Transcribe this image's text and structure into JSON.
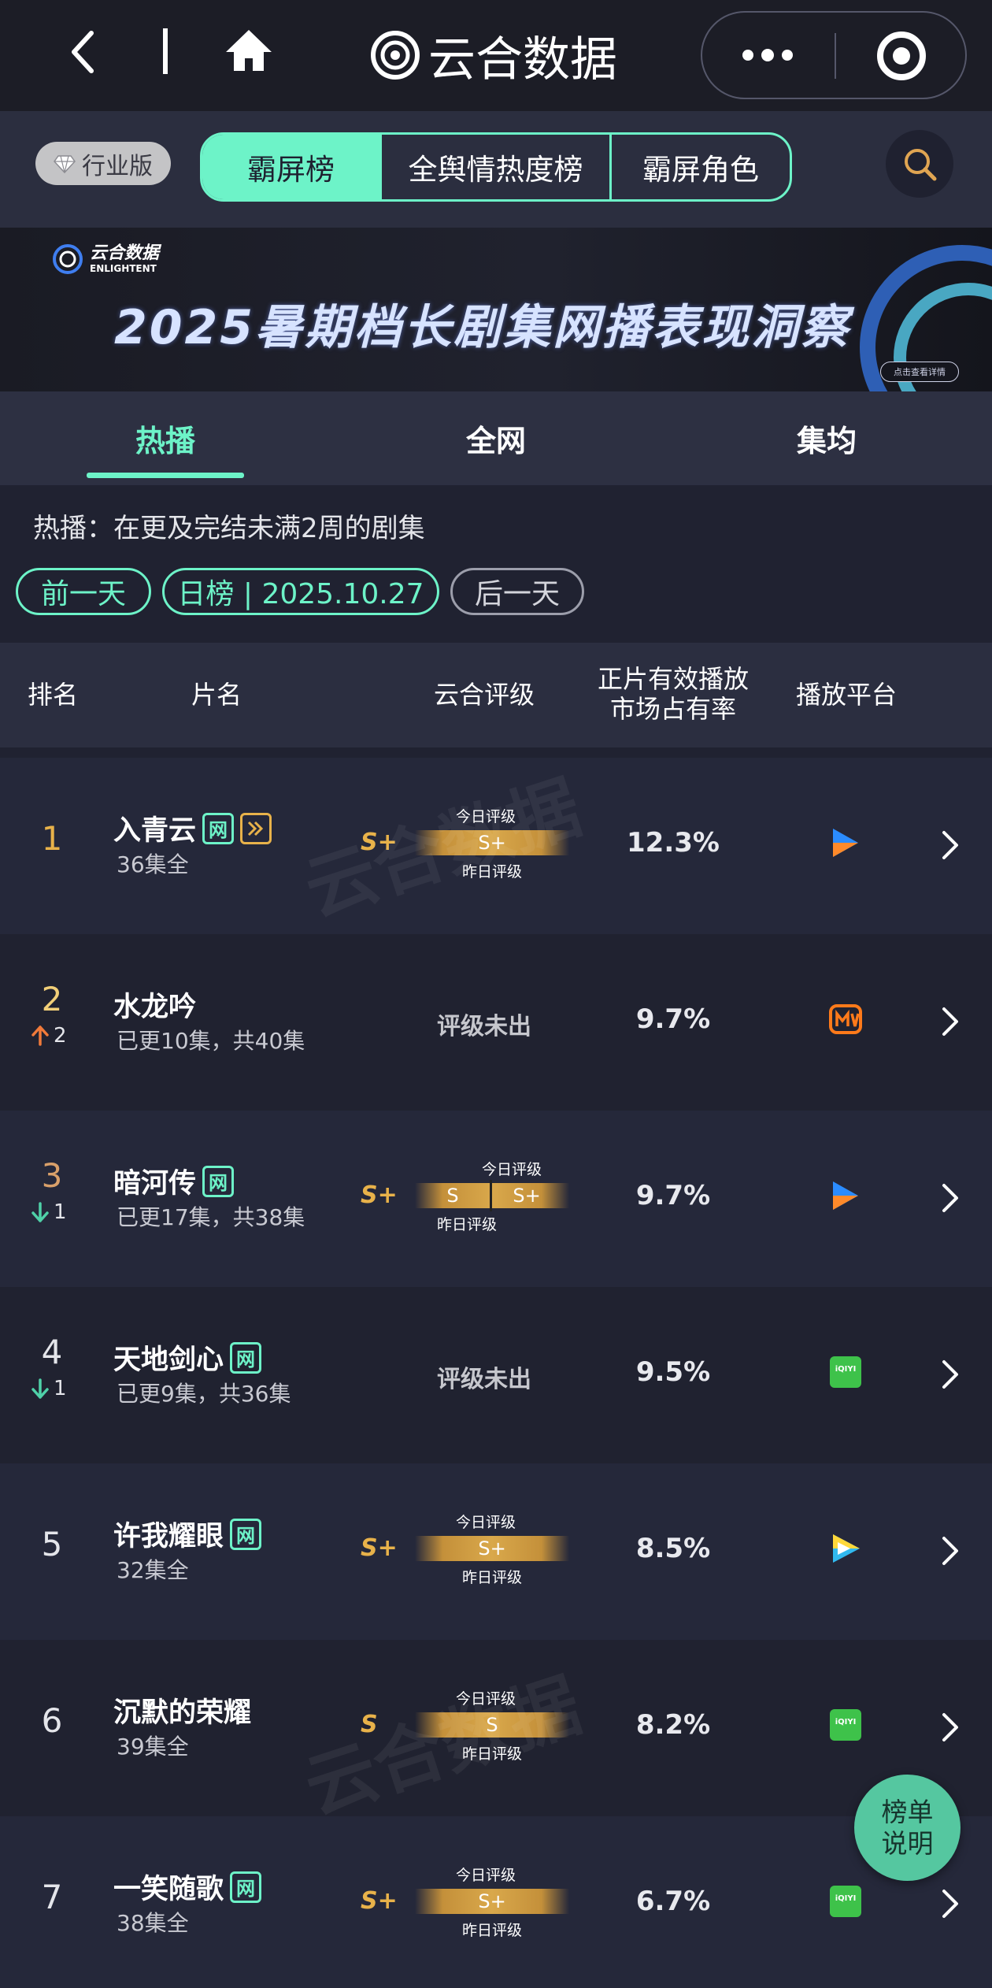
{
  "app": {
    "title": "云合数据"
  },
  "header": {
    "badge": "行业版",
    "segments": [
      "霸屏榜",
      "全舆情热度榜",
      "霸屏角色"
    ]
  },
  "banner": {
    "logo_cn": "云合数据",
    "logo_en": "ENLIGHTENT",
    "title": "2025暑期档长剧集网播表现洞察",
    "cta": "点击查看详情"
  },
  "tabs": [
    "热播",
    "全网",
    "集均"
  ],
  "note": "热播：在更及完结未满2周的剧集",
  "date_nav": {
    "prev": "前一天",
    "current": "日榜 | 2025.10.27",
    "next": "后一天"
  },
  "table": {
    "headers": {
      "rank": "排名",
      "title": "片名",
      "grade": "云合评级",
      "share_1": "正片有效播放",
      "share_2": "市场占有率",
      "platform": "播放平台"
    },
    "rows": [
      {
        "rank": "1",
        "title": "入青云",
        "tag_web": "网",
        "sub": "36集全",
        "grade": "S+",
        "bar": [
          "S+"
        ],
        "today_label": "今日评级",
        "yesterday_label": "昨日评级",
        "share": "12.3%",
        "platform": "tencent-video"
      },
      {
        "rank": "2",
        "change": "2",
        "title": "水龙吟",
        "sub": "已更10集，共40集",
        "grade_na": "评级未出",
        "share": "9.7%",
        "platform": "mango-tv"
      },
      {
        "rank": "3",
        "change": "1",
        "title": "暗河传",
        "tag_web": "网",
        "sub": "已更17集，共38集",
        "grade": "S+",
        "bar": [
          "S",
          "S+"
        ],
        "today_label": "今日评级",
        "yesterday_label": "昨日评级",
        "share": "9.7%",
        "platform": "tencent-video"
      },
      {
        "rank": "4",
        "change": "1",
        "title": "天地剑心",
        "tag_web": "网",
        "sub": "已更9集，共36集",
        "grade_na": "评级未出",
        "share": "9.5%",
        "platform": "iqiyi",
        "platform_text": "iQIYI"
      },
      {
        "rank": "5",
        "title": "许我耀眼",
        "tag_web": "网",
        "sub": "32集全",
        "grade": "S+",
        "bar": [
          "S+"
        ],
        "today_label": "今日评级",
        "yesterday_label": "昨日评级",
        "share": "8.5%",
        "platform": "youku"
      },
      {
        "rank": "6",
        "title": "沉默的荣耀",
        "sub": "39集全",
        "grade": "S",
        "bar": [
          "S"
        ],
        "today_label": "今日评级",
        "yesterday_label": "昨日评级",
        "share": "8.2%",
        "platform": "iqiyi",
        "platform_text": "iQIYI"
      },
      {
        "rank": "7",
        "title": "一笑随歌",
        "tag_web": "网",
        "sub": "38集全",
        "grade": "S+",
        "bar": [
          "S+"
        ],
        "today_label": "今日评级",
        "yesterday_label": "昨日评级",
        "share": "6.7%",
        "platform": "iqiyi",
        "platform_text": "iQIYI"
      }
    ]
  },
  "float_button": {
    "line1": "榜单",
    "line2": "说明"
  },
  "colors": {
    "accent": "#6df3c8",
    "gold": "#e8b24a",
    "up": "#f07a3a",
    "down": "#4fd1a8"
  }
}
